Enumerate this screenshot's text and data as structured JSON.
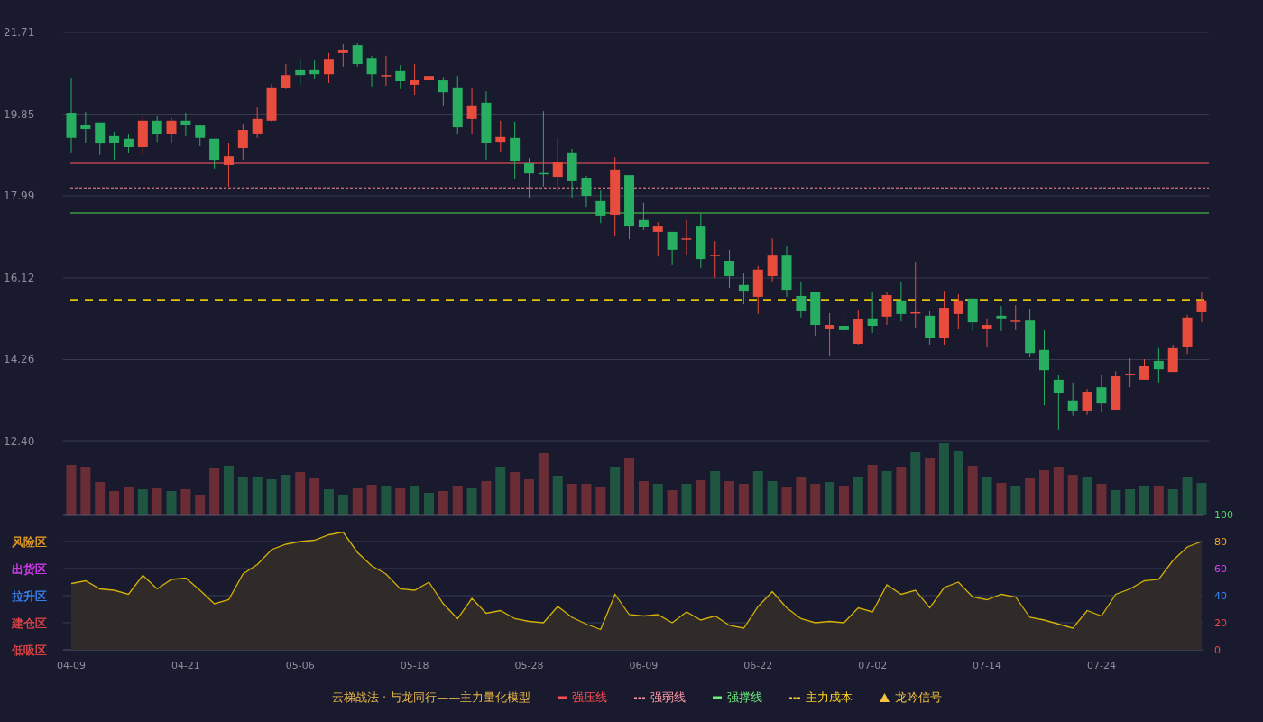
{
  "price_chart": {
    "chart_data": {
      "type": "candlestick",
      "ylim": [
        12.4,
        21.71
      ],
      "grid": true,
      "yticks": [
        {
          "value": 21.71,
          "label": "21.71"
        },
        {
          "value": 19.85,
          "label": "19.85"
        },
        {
          "value": 17.99,
          "label": "17.99"
        },
        {
          "value": 16.12,
          "label": "16.12"
        },
        {
          "value": 14.26,
          "label": "14.26"
        },
        {
          "value": 12.4,
          "label": "12.40"
        }
      ],
      "ohlc": [
        [
          19.88,
          20.68,
          18.98,
          19.31
        ],
        [
          19.61,
          19.9,
          19.2,
          19.51
        ],
        [
          19.66,
          19.66,
          18.92,
          19.18
        ],
        [
          19.35,
          19.45,
          18.81,
          19.2
        ],
        [
          19.29,
          19.39,
          18.96,
          19.1
        ],
        [
          19.1,
          19.82,
          18.92,
          19.7
        ],
        [
          19.7,
          19.82,
          19.22,
          19.39
        ],
        [
          19.39,
          19.76,
          19.2,
          19.7
        ],
        [
          19.7,
          19.88,
          19.35,
          19.61
        ],
        [
          19.59,
          19.59,
          19.12,
          19.31
        ],
        [
          19.29,
          19.29,
          18.61,
          18.81
        ],
        [
          18.69,
          19.2,
          18.2,
          18.89
        ],
        [
          19.08,
          19.63,
          18.81,
          19.49
        ],
        [
          19.41,
          20.0,
          19.31,
          19.74
        ],
        [
          19.7,
          20.54,
          19.68,
          20.46
        ],
        [
          20.44,
          20.99,
          20.42,
          20.74
        ],
        [
          20.85,
          21.11,
          20.52,
          20.74
        ],
        [
          20.85,
          21.07,
          20.66,
          20.76
        ],
        [
          20.76,
          21.24,
          20.56,
          21.11
        ],
        [
          21.24,
          21.44,
          20.93,
          21.32
        ],
        [
          21.42,
          21.46,
          20.93,
          20.99
        ],
        [
          21.13,
          21.18,
          20.48,
          20.76
        ],
        [
          20.73,
          21.18,
          20.5,
          20.74
        ],
        [
          20.83,
          20.97,
          20.42,
          20.6
        ],
        [
          20.52,
          20.99,
          20.29,
          20.62
        ],
        [
          20.62,
          21.24,
          20.44,
          20.72
        ],
        [
          20.62,
          20.7,
          20.05,
          20.35
        ],
        [
          20.46,
          20.72,
          19.39,
          19.55
        ],
        [
          19.74,
          20.44,
          19.39,
          20.05
        ],
        [
          20.11,
          20.37,
          18.81,
          19.2
        ],
        [
          19.22,
          19.7,
          19.0,
          19.33
        ],
        [
          19.31,
          19.68,
          18.38,
          18.79
        ],
        [
          18.73,
          18.85,
          17.95,
          18.5
        ],
        [
          18.51,
          19.92,
          18.2,
          18.5
        ],
        [
          18.42,
          19.31,
          18.09,
          18.77
        ],
        [
          18.98,
          19.06,
          17.95,
          18.32
        ],
        [
          18.4,
          18.44,
          17.74,
          17.99
        ],
        [
          17.87,
          18.11,
          17.37,
          17.54
        ],
        [
          17.56,
          18.87,
          17.07,
          18.59
        ],
        [
          18.46,
          18.46,
          17.0,
          17.31
        ],
        [
          17.44,
          17.83,
          17.21,
          17.29
        ],
        [
          17.17,
          17.39,
          16.61,
          17.31
        ],
        [
          17.17,
          17.17,
          16.41,
          16.76
        ],
        [
          17.01,
          17.44,
          16.63,
          17.02
        ],
        [
          17.31,
          17.58,
          16.35,
          16.55
        ],
        [
          16.64,
          16.96,
          16.12,
          16.65
        ],
        [
          16.51,
          16.76,
          15.89,
          16.16
        ],
        [
          15.96,
          16.22,
          15.52,
          15.83
        ],
        [
          15.69,
          16.39,
          15.3,
          16.31
        ],
        [
          16.16,
          17.02,
          16.04,
          16.63
        ],
        [
          16.63,
          16.84,
          15.69,
          15.85
        ],
        [
          15.71,
          16.02,
          15.22,
          15.36
        ],
        [
          15.81,
          15.81,
          14.8,
          15.05
        ],
        [
          14.97,
          15.32,
          14.35,
          15.05
        ],
        [
          15.03,
          15.32,
          14.78,
          14.93
        ],
        [
          14.62,
          15.38,
          14.6,
          15.18
        ],
        [
          15.2,
          15.81,
          14.87,
          15.03
        ],
        [
          15.24,
          15.81,
          15.05,
          15.73
        ],
        [
          15.61,
          16.04,
          15.13,
          15.3
        ],
        [
          15.33,
          16.49,
          14.99,
          15.34
        ],
        [
          15.26,
          15.36,
          14.6,
          14.76
        ],
        [
          14.76,
          15.83,
          14.6,
          15.44
        ],
        [
          15.3,
          15.75,
          14.95,
          15.61
        ],
        [
          15.65,
          15.67,
          14.91,
          15.11
        ],
        [
          14.97,
          15.2,
          14.54,
          15.05
        ],
        [
          15.26,
          15.48,
          14.91,
          15.2
        ],
        [
          15.13,
          15.5,
          14.93,
          15.15
        ],
        [
          15.15,
          15.42,
          14.31,
          14.41
        ],
        [
          14.48,
          14.93,
          13.22,
          14.02
        ],
        [
          13.8,
          13.92,
          12.67,
          13.51
        ],
        [
          13.33,
          13.74,
          12.98,
          13.1
        ],
        [
          13.1,
          13.59,
          13.0,
          13.53
        ],
        [
          13.63,
          13.9,
          13.06,
          13.26
        ],
        [
          13.12,
          14.0,
          13.12,
          13.88
        ],
        [
          13.93,
          14.29,
          13.63,
          13.94
        ],
        [
          13.8,
          14.27,
          13.8,
          14.11
        ],
        [
          14.23,
          14.52,
          13.74,
          14.04
        ],
        [
          13.98,
          14.6,
          13.98,
          14.52
        ],
        [
          14.54,
          15.28,
          14.39,
          15.22
        ],
        [
          15.34,
          15.81,
          15.11,
          15.61
        ]
      ],
      "ref_lines": [
        {
          "axis": "y",
          "value": 18.73,
          "color": "#b8454f"
        },
        {
          "axis": "y",
          "value": 18.17,
          "color": "#ff8c95"
        },
        {
          "axis": "y",
          "value": 17.6,
          "color": "#3f9a43"
        },
        {
          "axis": "y",
          "value": 15.62,
          "color": "#e8c200"
        }
      ]
    }
  },
  "indicator": {
    "zones": [
      {
        "label": "风险区",
        "color": "#f5a623"
      },
      {
        "label": "出货区",
        "color": "#e040fb"
      },
      {
        "label": "拉升区",
        "color": "#3d8bff"
      },
      {
        "label": "建仓区",
        "color": "#f04848"
      },
      {
        "label": "低吸区",
        "color": "#f04848"
      }
    ],
    "right_axis": [
      {
        "color": "#4cd964"
      },
      {
        "color": "#f5a623"
      },
      {
        "color": "#e040fb"
      },
      {
        "color": "#3d8bff"
      },
      {
        "color": "#f04848"
      },
      {
        "color": "#f04848"
      }
    ],
    "chart_data": {
      "type": "area",
      "ylim": [
        0,
        100
      ],
      "grid": true,
      "categories": [
        "04-09",
        null,
        null,
        null,
        null,
        null,
        null,
        null,
        "04-21",
        null,
        null,
        null,
        null,
        null,
        null,
        null,
        "05-06",
        null,
        null,
        null,
        null,
        null,
        null,
        null,
        "05-18",
        null,
        null,
        null,
        null,
        null,
        null,
        null,
        "05-28",
        null,
        null,
        null,
        null,
        null,
        null,
        null,
        "06-09",
        null,
        null,
        null,
        null,
        null,
        null,
        null,
        "06-22",
        null,
        null,
        null,
        null,
        null,
        null,
        null,
        "07-02",
        null,
        null,
        null,
        null,
        null,
        null,
        null,
        "07-14",
        null,
        null,
        null,
        null,
        null,
        null,
        null,
        "07-24",
        null,
        null,
        null,
        null,
        null,
        null,
        null
      ],
      "yticks": [
        {
          "value": 100,
          "label": "100"
        },
        {
          "value": 80,
          "label": "80"
        },
        {
          "value": 60,
          "label": "60"
        },
        {
          "value": 40,
          "label": "40"
        },
        {
          "value": 20,
          "label": "20"
        },
        {
          "value": 0,
          "label": "0"
        }
      ],
      "series": [
        {
          "color": "#d4b106",
          "values": [
            49,
            51,
            45,
            44,
            41,
            55,
            45,
            52,
            53,
            44,
            34,
            37,
            56,
            63,
            74,
            78,
            80,
            81,
            85,
            87,
            72,
            62,
            56,
            45,
            44,
            50,
            34,
            23,
            38,
            27,
            29,
            23,
            21,
            20,
            32,
            24,
            19,
            15,
            41,
            26,
            25,
            26,
            20,
            28,
            22,
            25,
            18,
            16,
            32,
            43,
            31,
            23,
            20,
            21,
            20,
            31,
            28,
            48,
            41,
            44,
            31,
            46,
            50,
            39,
            37,
            41,
            39,
            24,
            22,
            19,
            16,
            29,
            25,
            41,
            45,
            51,
            52,
            66,
            76,
            80
          ]
        }
      ]
    }
  },
  "legend": {
    "title": "云梯战法 · 与龙同行——主力量化模型",
    "items": [
      {
        "label": "强压线",
        "kind": "line",
        "color": "#ff4d4f"
      },
      {
        "label": "强弱线",
        "kind": "dotted",
        "color": "#ff9aa8"
      },
      {
        "label": "强撑线",
        "kind": "line",
        "color": "#6cf07a"
      },
      {
        "label": "主力成本",
        "kind": "dotted",
        "color": "#ffd31a"
      },
      {
        "label": "龙吟信号",
        "kind": "triangle",
        "color": "#f5c242"
      }
    ]
  }
}
